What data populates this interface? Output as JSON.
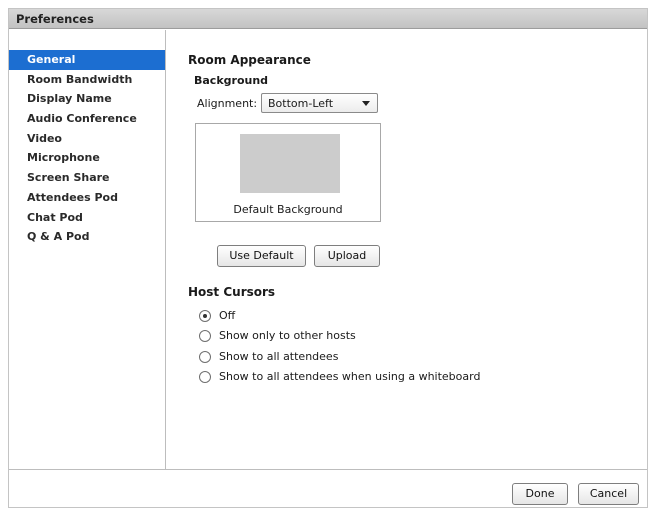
{
  "window": {
    "title": "Preferences"
  },
  "sidebar": {
    "items": [
      {
        "label": "General",
        "selected": true
      },
      {
        "label": "Room Bandwidth"
      },
      {
        "label": "Display Name"
      },
      {
        "label": "Audio Conference"
      },
      {
        "label": "Video"
      },
      {
        "label": "Microphone"
      },
      {
        "label": "Screen Share"
      },
      {
        "label": "Attendees Pod"
      },
      {
        "label": "Chat Pod"
      },
      {
        "label": "Q & A Pod"
      }
    ]
  },
  "room_appearance": {
    "title": "Room Appearance",
    "background_label": "Background",
    "alignment_label": "Alignment:",
    "alignment_value": "Bottom-Left",
    "preview_caption": "Default Background",
    "use_default_label": "Use Default",
    "upload_label": "Upload"
  },
  "host_cursors": {
    "title": "Host Cursors",
    "options": [
      {
        "label": "Off",
        "checked": true
      },
      {
        "label": "Show only to other hosts",
        "checked": false
      },
      {
        "label": "Show to all attendees",
        "checked": false
      },
      {
        "label": "Show to all attendees when using a whiteboard",
        "checked": false
      }
    ]
  },
  "footer": {
    "done_label": "Done",
    "cancel_label": "Cancel"
  },
  "colors": {
    "selection": "#1c6ed1",
    "swatch": "#cccccc"
  }
}
